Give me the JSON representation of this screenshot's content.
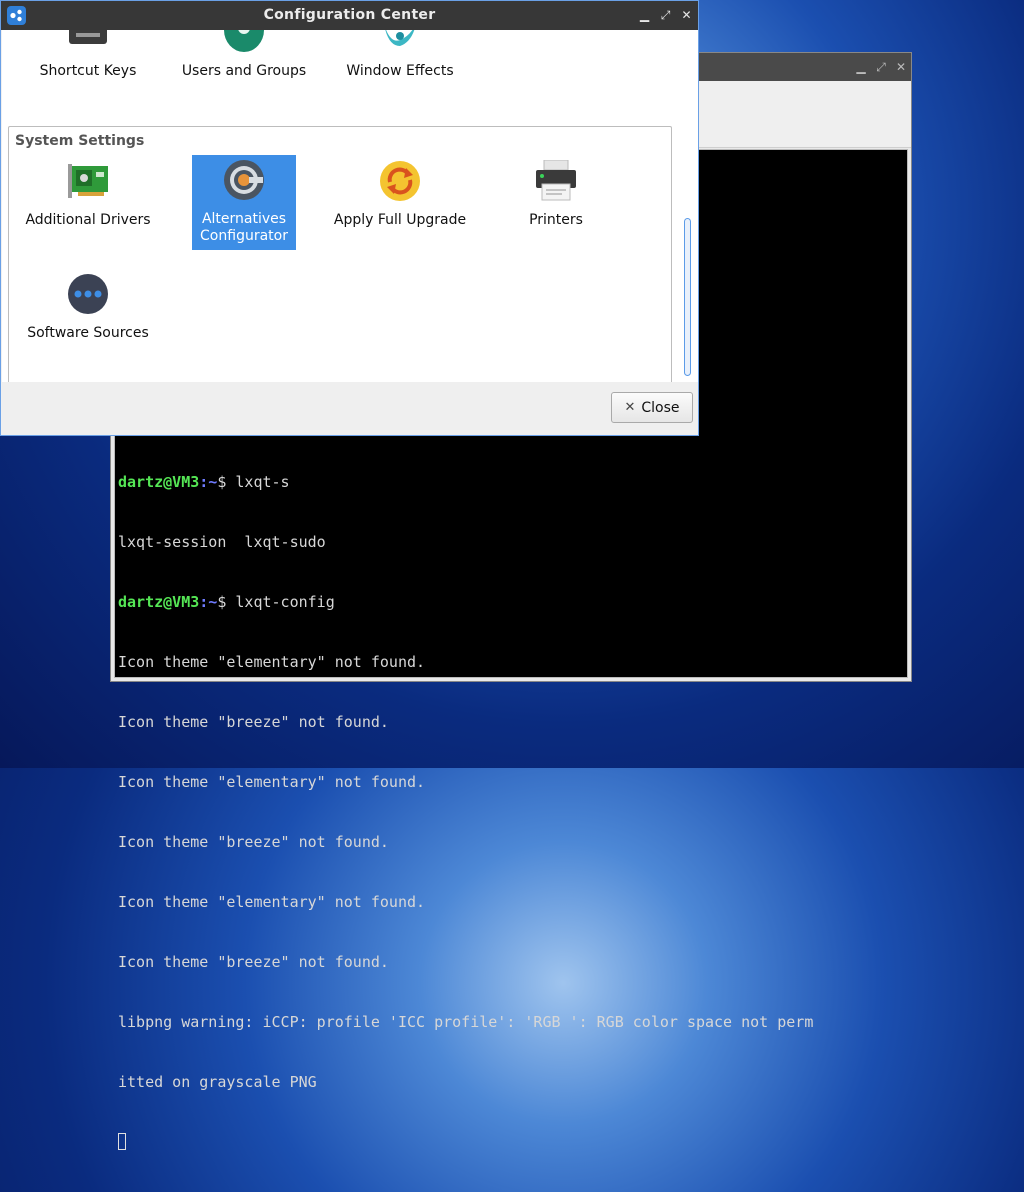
{
  "terminal": {
    "lines": [
      {
        "user": "dartz@VM3",
        "path": ":~",
        "cmd": "$ lxqt-s"
      },
      {
        "text": "lxqt-session  lxqt-sudo"
      },
      {
        "user": "dartz@VM3",
        "path": ":~",
        "cmd": "$ lxqt-config"
      },
      {
        "text": "Icon theme \"elementary\" not found."
      },
      {
        "text": "Icon theme \"breeze\" not found."
      },
      {
        "text": "Icon theme \"elementary\" not found."
      },
      {
        "text": "Icon theme \"breeze\" not found."
      },
      {
        "text": "Icon theme \"elementary\" not found."
      },
      {
        "text": "Icon theme \"breeze\" not found."
      },
      {
        "text": "libpng warning: iCCP: profile 'ICC profile': 'RGB ': RGB color space not perm"
      },
      {
        "text": "itted on grayscale PNG"
      }
    ],
    "window_buttons": [
      "minimize-icon",
      "maximize-icon",
      "close-icon"
    ]
  },
  "config_center": {
    "title": "Configuration Center",
    "top_items": [
      {
        "label": "Shortcut Keys",
        "icon": "keyboard-icon"
      },
      {
        "label": "Users and Groups",
        "icon": "users-icon"
      },
      {
        "label": "Window Effects",
        "icon": "window-effects-icon"
      }
    ],
    "section_title": "System Settings",
    "system_items": [
      {
        "label": "Additional Drivers",
        "icon": "hardware-card-icon"
      },
      {
        "label_line1": "Alternatives",
        "label_line2": "Configurator",
        "icon": "alternatives-icon",
        "selected": true
      },
      {
        "label": "Apply Full Upgrade",
        "icon": "upgrade-icon"
      },
      {
        "label": "Printers",
        "icon": "printer-icon"
      },
      {
        "label": "Software Sources",
        "icon": "software-sources-icon"
      }
    ],
    "close_label": "Close",
    "colors": {
      "selection": "#3d8ee6",
      "titlebar": "#373737",
      "prompt_user": "#55e655",
      "prompt_path": "#6f7bff"
    }
  }
}
